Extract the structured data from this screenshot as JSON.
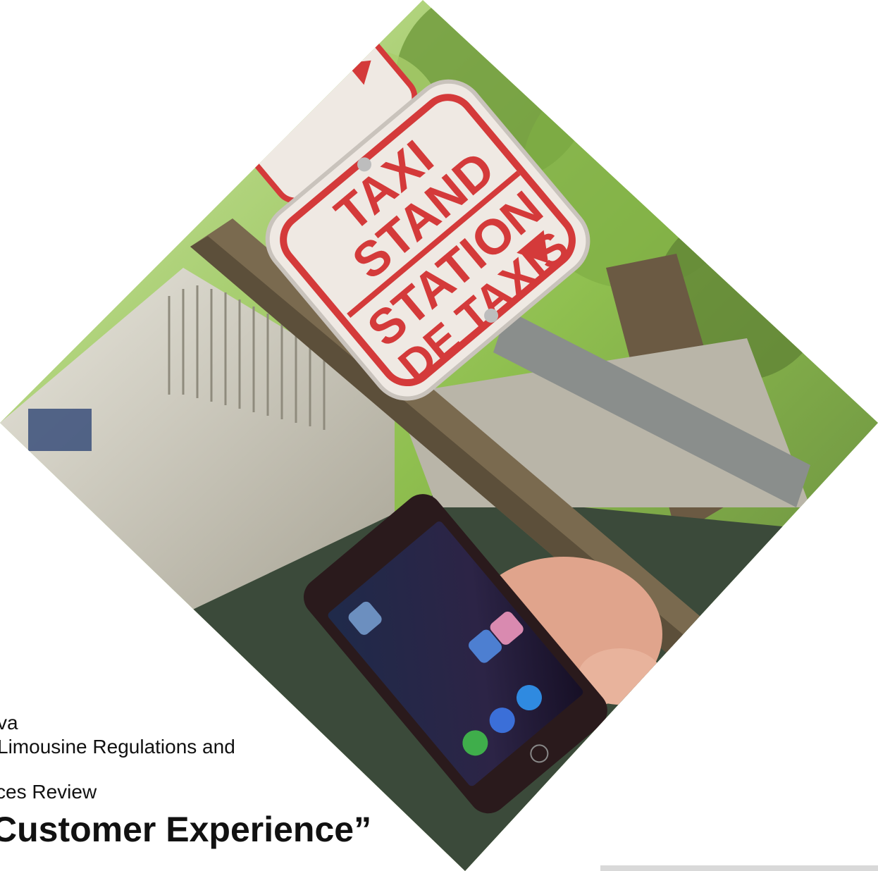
{
  "sign": {
    "line1": "TAXI",
    "line2": "STAND",
    "line3": "STATION",
    "line4": "DE TAXIS"
  },
  "text": {
    "line1": "va",
    "line2": "Limousine Regulations and",
    "line3": "ces Review",
    "headline": "Customer Experience”"
  },
  "colors": {
    "sign_red": "#d43a3a",
    "sign_bg": "#efe9e3",
    "text": "#111111"
  }
}
